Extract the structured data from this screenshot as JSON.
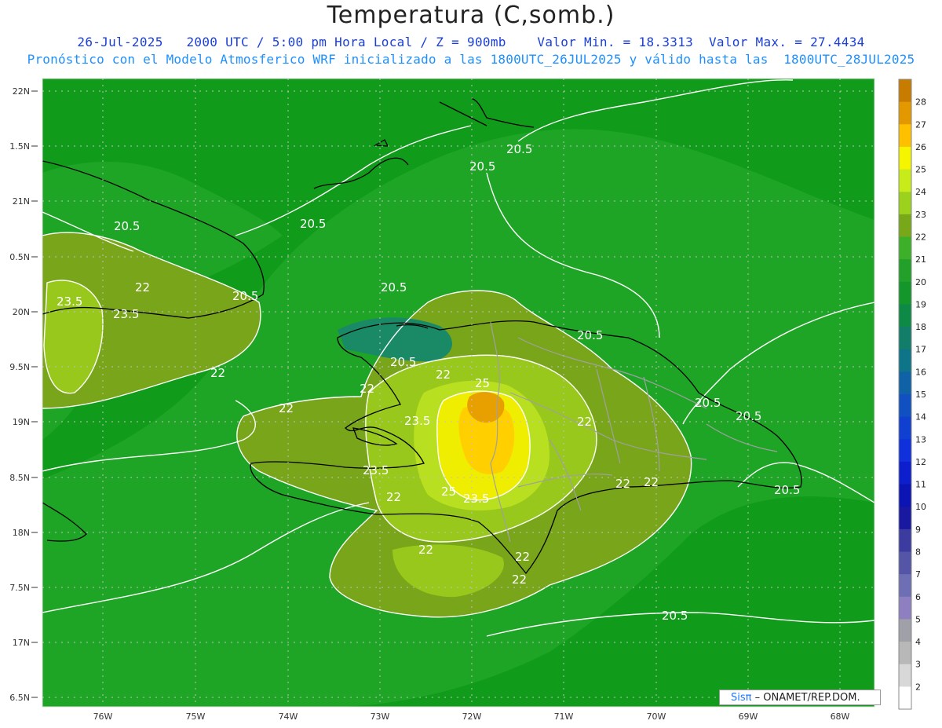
{
  "header": {
    "title": "Temperatura (C,somb.)",
    "subtitle_line1": "26-Jul-2025   2000 UTC / 5:00 pm Hora Local / Z = 900mb    Valor Min. = 18.3313  Valor Max. = 27.4434",
    "subtitle_line2": "Pronóstico con el Modelo Atmosferico WRF inicializado a las 1800UTC_26JUL2025 y válido hasta las  1800UTC_28JUL2025"
  },
  "map": {
    "lat_labels": [
      "22N",
      "1.5N",
      "21N",
      "0.5N",
      "20N",
      "9.5N",
      "19N",
      "8.5N",
      "18N",
      "7.5N",
      "17N",
      "6.5N"
    ],
    "lon_labels": [
      "76W",
      "75W",
      "74W",
      "73W",
      "72W",
      "71W",
      "70W",
      "69W",
      "68W"
    ],
    "contour_labels": [
      "20.5",
      "20.5",
      "20.5",
      "20.5",
      "20.5",
      "20.5",
      "20.5",
      "20.5",
      "20.5",
      "20.5",
      "20.5",
      "20.5",
      "22",
      "22",
      "22",
      "22",
      "22",
      "22",
      "22",
      "22",
      "22",
      "22",
      "22",
      "22",
      "23.5",
      "23.5",
      "23.5",
      "23.5",
      "23.5",
      "25",
      "25"
    ],
    "colors": {
      "background_green": "#119b1b",
      "level_21_green": "#22a82a",
      "level_22_olive": "#79a51a",
      "level_23_lightgreen": "#98c81c",
      "level_24_yellowgreen": "#b8e020",
      "level_25_yellow": "#f0f000",
      "level_26_gold": "#ffd400",
      "level_27_orange": "#e8a000",
      "teal_cool": "#1a8a66",
      "contour_line": "#ffffff",
      "border_gray": "#a0a0a0"
    }
  },
  "colorbar": {
    "labels": [
      "28",
      "27",
      "26",
      "25",
      "24",
      "23",
      "22",
      "21",
      "20",
      "19",
      "18",
      "17",
      "16",
      "15",
      "14",
      "13",
      "12",
      "11",
      "10",
      "9",
      "8",
      "7",
      "6",
      "5",
      "4",
      "3",
      "2"
    ],
    "colors": [
      "#c77c00",
      "#e49800",
      "#ffc000",
      "#f5f500",
      "#c8ec1a",
      "#9cd21e",
      "#78a81a",
      "#3cb028",
      "#22a02a",
      "#14962a",
      "#0f8a46",
      "#127e6a",
      "#0e7487",
      "#1062a6",
      "#1050c0",
      "#1040d0",
      "#1030dc",
      "#0d1fcc",
      "#0c14b4",
      "#1818a0",
      "#3b3ba0",
      "#5555a8",
      "#6e6eb4",
      "#8e80c0",
      "#a0a0a8",
      "#b8b8b8",
      "#d8d8d8",
      "#ffffff"
    ]
  },
  "logo": {
    "sis": "Sisπ",
    "org": "– ONAMET/REP.DOM."
  }
}
